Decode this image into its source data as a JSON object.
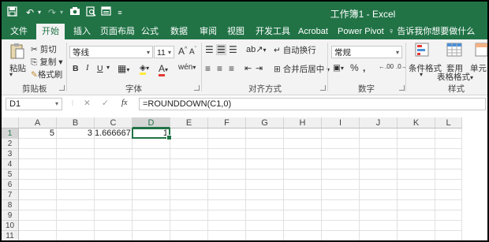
{
  "quick_access": {
    "save_icon": "save-icon",
    "undo_icon": "undo-icon",
    "redo_icon": "redo-icon",
    "camera_icon": "camera-icon",
    "print_preview_icon": "print-preview-icon",
    "form_icon": "form-icon",
    "customize_icon": "customize-toolbar-icon"
  },
  "window": {
    "title": "工作簿1 - Excel"
  },
  "tabs": [
    {
      "label": "文件"
    },
    {
      "label": "开始"
    },
    {
      "label": "插入"
    },
    {
      "label": "页面布局"
    },
    {
      "label": "公式"
    },
    {
      "label": "数据"
    },
    {
      "label": "审阅"
    },
    {
      "label": "视图"
    },
    {
      "label": "开发工具"
    },
    {
      "label": "Acrobat"
    },
    {
      "label": "Power Pivot"
    }
  ],
  "active_tab": "开始",
  "tell_me": {
    "icon": "lightbulb-icon",
    "text": "告诉我你想要做什么"
  },
  "ribbon": {
    "clipboard": {
      "paste": "粘贴",
      "cut": "剪切",
      "copy": "复制",
      "format_painter": "格式刷",
      "group_label": "剪贴板"
    },
    "font": {
      "name": "等线",
      "size": "11",
      "bold": "B",
      "italic": "I",
      "underline": "U",
      "grow": "A",
      "shrink": "A",
      "phonetic": "wén",
      "group_label": "字体"
    },
    "alignment": {
      "wrap": "自动换行",
      "merge": "合并后居中",
      "group_label": "对齐方式"
    },
    "number": {
      "format": "常规",
      "percent": "%",
      "comma": ",",
      "inc_decimal": ".00",
      "dec_decimal": ".0",
      "group_label": "数字"
    },
    "styles": {
      "conditional": "条件格式",
      "table_line1": "套用",
      "table_line2": "表格格式",
      "cell_styles": "单元",
      "group_label": "样式"
    }
  },
  "formula_bar": {
    "name_box": "D1",
    "cancel": "✕",
    "enter": "✓",
    "fx": "fx",
    "formula": "=ROUNDDOWN(C1,0)"
  },
  "columns": [
    "A",
    "B",
    "C",
    "D",
    "E",
    "F",
    "G",
    "H",
    "I",
    "J",
    "K",
    "L"
  ],
  "rows": [
    "1",
    "2",
    "3",
    "4",
    "5",
    "6",
    "7",
    "8",
    "9",
    "10",
    "11"
  ],
  "cells": {
    "A1": "5",
    "B1": "3",
    "C1": "1.666667",
    "D1": "1"
  },
  "active_cell": "D1",
  "colors": {
    "brand": "#217346",
    "ribbon_bg": "#f3f3f3"
  }
}
